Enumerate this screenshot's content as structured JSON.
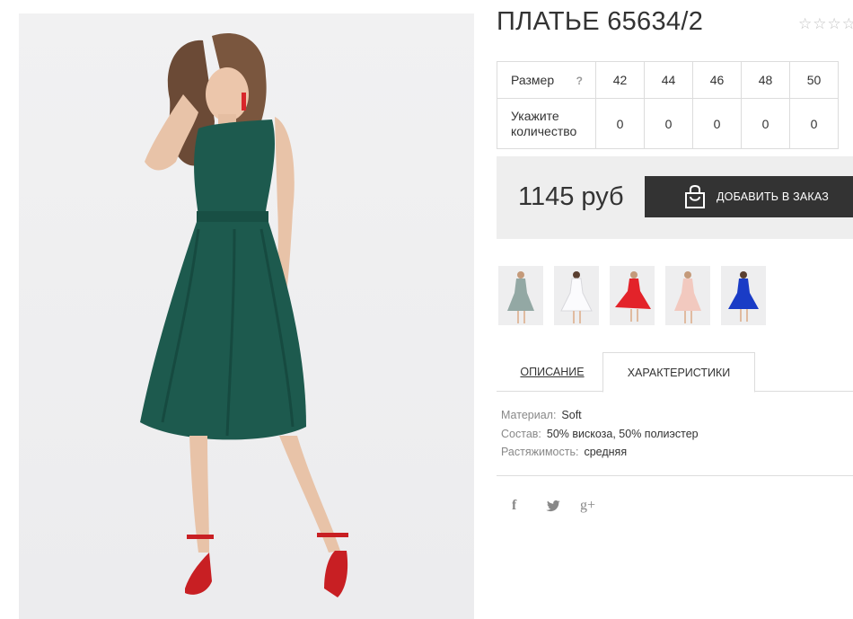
{
  "product": {
    "title": "ПЛАТЬЕ 65634/2",
    "rating_stars": "☆☆☆☆☆",
    "main_image": "green-dress-model-photo"
  },
  "size_table": {
    "size_label": "Размер",
    "help": "?",
    "sizes": [
      "42",
      "44",
      "46",
      "48",
      "50"
    ],
    "qty_label": "Укажите количество",
    "quantities": [
      "0",
      "0",
      "0",
      "0",
      "0"
    ]
  },
  "price": {
    "value": "1145 руб",
    "order_button": "ДОБАВИТЬ В ЗАКАЗ",
    "order_icon": "shopping-bag-icon"
  },
  "thumbnails": [
    {
      "color": "#93a8a4"
    },
    {
      "color": "#f6f6f8"
    },
    {
      "color": "#e3232a"
    },
    {
      "color": "#f2c9bf"
    },
    {
      "color": "#1a3cc6"
    }
  ],
  "tabs": {
    "description": "ОПИСАНИЕ",
    "characteristics": "ХАРАКТЕРИСТИКИ"
  },
  "characteristics": {
    "material_key": "Материал:",
    "material_val": "Soft",
    "composition_key": "Состав:",
    "composition_val": "50% вискоза, 50% полиэстер",
    "stretch_key": "Растяжимость:",
    "stretch_val": "средняя"
  },
  "social": {
    "facebook": "f",
    "twitter": "twitter-icon",
    "gplus": "g+"
  },
  "colors": {
    "dress": "#1d5a4e",
    "button_bg": "#333333",
    "price_box_bg": "#eeeeee"
  }
}
